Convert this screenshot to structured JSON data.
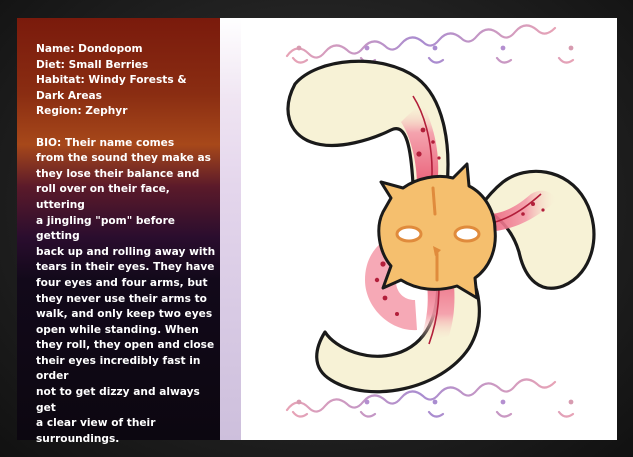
{
  "info": {
    "name": "Name: Dondopom",
    "diet": "Diet: Small Berries",
    "habitat_line1": "Habitat: Windy Forests &",
    "habitat_line2": "Dark Areas",
    "region": "Region: Zephyr"
  },
  "bio": [
    "BIO: Their name comes",
    "from the sound they make as",
    "they lose their balance and",
    "roll over on their face, uttering",
    "a jingling \"pom\" before getting",
    "back up and rolling away with",
    "tears in their eyes. They have",
    "four eyes and four arms, but",
    "they never use their arms to",
    "walk, and only keep two eyes",
    "open while standing. When",
    "they roll, they open and close",
    "their eyes incredibly fast in order",
    "not to get dizzy and always get",
    "a clear view of their",
    "surroundings."
  ],
  "colors": {
    "panel_top": "#7a1a0c",
    "panel_bottom": "#0c0710",
    "arm_fill": "#f7f2d6",
    "arm_pink": "#f06a84",
    "body_fill": "#f5bf6e",
    "ornament": "#b98cc4"
  }
}
